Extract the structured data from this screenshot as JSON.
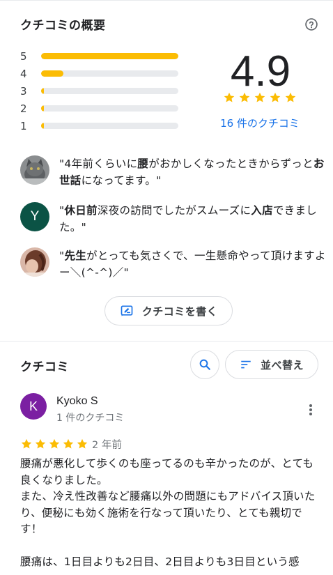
{
  "summary": {
    "title": "クチコミの概要",
    "rating": "4.9",
    "review_count_link": "16 件のクチコミ",
    "bars": [
      {
        "label": "5",
        "fraction": 1.0
      },
      {
        "label": "4",
        "fraction": 0.16
      },
      {
        "label": "3",
        "fraction": 0.015
      },
      {
        "label": "2",
        "fraction": 0.015
      },
      {
        "label": "1",
        "fraction": 0.015
      }
    ],
    "star_color": "#fbbc04",
    "link_color": "#1a73e8"
  },
  "snippets": [
    {
      "parts": [
        {
          "t": "\"4年前くらいに"
        },
        {
          "t": "腰",
          "b": true
        },
        {
          "t": "がおかしくなったときからずっと"
        },
        {
          "t": "お世話",
          "b": true
        },
        {
          "t": "になってます。\""
        }
      ]
    },
    {
      "avatar_letter": "Y",
      "avatar_color": "#0b5345",
      "parts": [
        {
          "t": "\""
        },
        {
          "t": "休日前",
          "b": true
        },
        {
          "t": "深夜の訪問でしたがスムーズに"
        },
        {
          "t": "入店",
          "b": true
        },
        {
          "t": "できました。\""
        }
      ]
    },
    {
      "parts": [
        {
          "t": "\""
        },
        {
          "t": "先生",
          "b": true
        },
        {
          "t": "がとっても気さくで、一生懸命やって頂けますよー＼(^-^)／\""
        }
      ]
    }
  ],
  "write_button_label": "クチコミを書く",
  "reviews_section": {
    "title": "クチコミ",
    "sort_label": "並べ替え"
  },
  "review": {
    "avatar_letter": "K",
    "avatar_color": "#7b1fa2",
    "name": "Kyoko S",
    "meta": "1 件のクチコミ",
    "stars": 5,
    "date": "2 年前",
    "body": "腰痛が悪化して歩くのも座ってるのも辛かったのが、とても良くなりました。\nまた、冷え性改善など腰痛以外の問題にもアドバイス頂いたり、便秘にも効く施術を行なって頂いたり、とても親切です！\n\n腰痛は、1日目よりも2日目、2日目よりも3日目という感"
  }
}
